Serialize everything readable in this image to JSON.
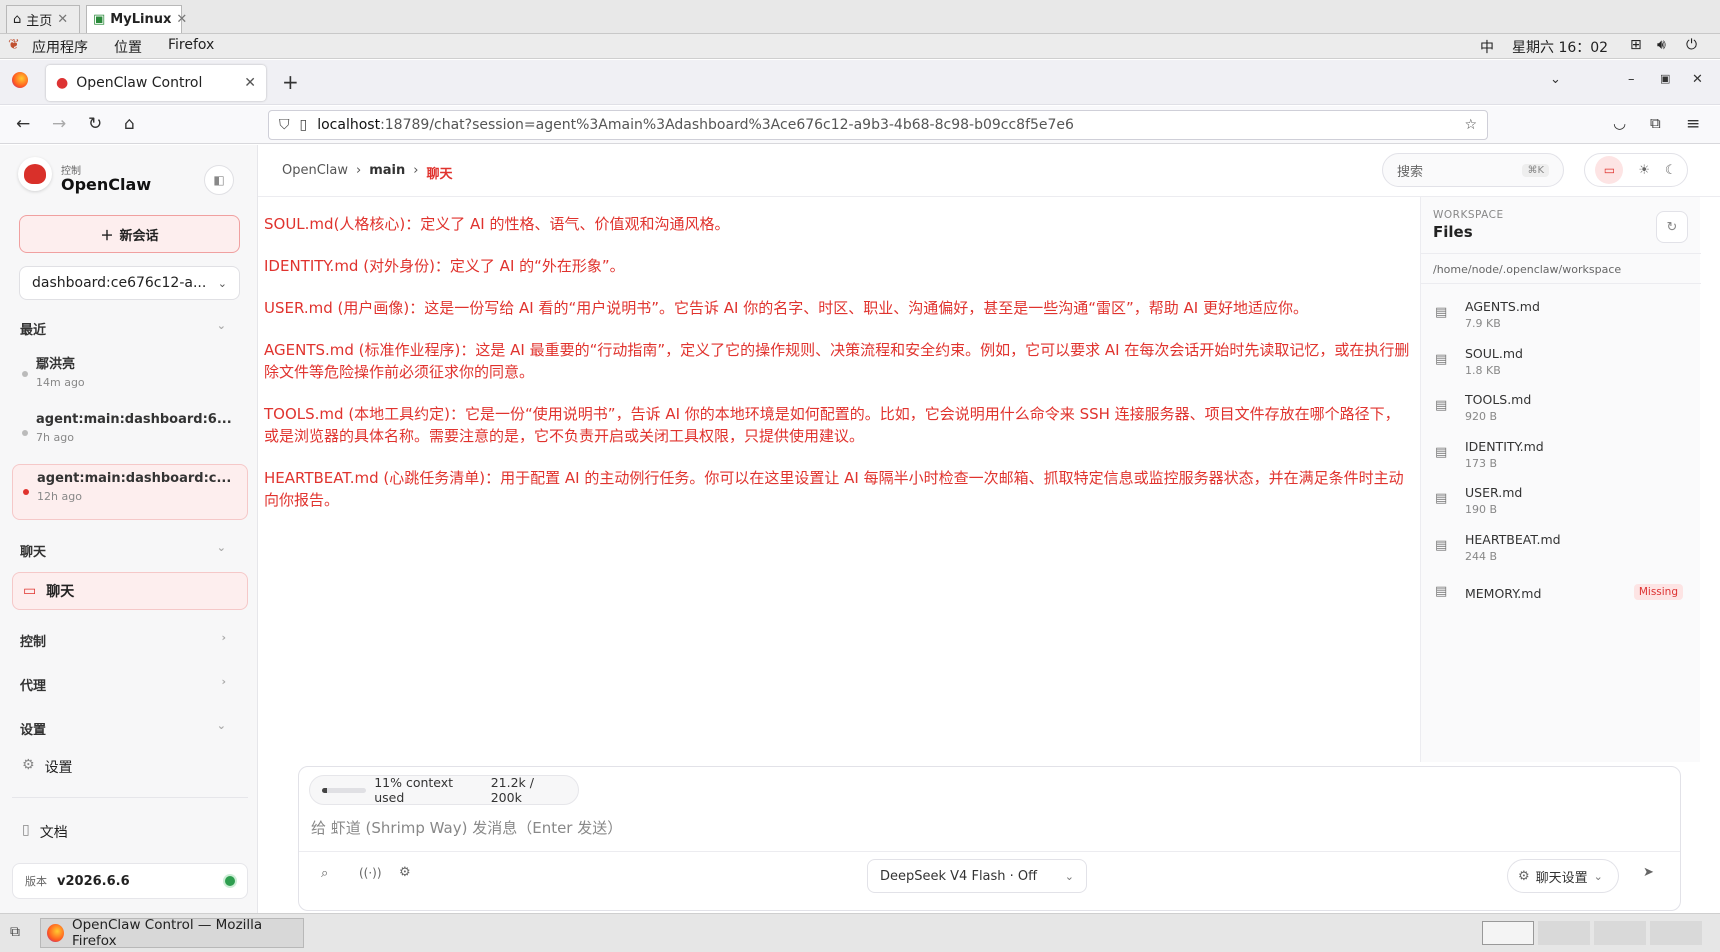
{
  "vnc": {
    "tab1": "主页",
    "tab2": "MyLinux"
  },
  "gnome": {
    "apps": "应用程序",
    "places": "位置",
    "firefox": "Firefox",
    "ime": "中",
    "clock": "星期六 16：02"
  },
  "browser": {
    "tab_title": "OpenClaw Control",
    "url_host": "localhost",
    "url_rest": ":18789/chat?session=agent%3Amain%3Adashboard%3Ace676c12-a9b3-4b68-8c98-b09cc8f5e7e6"
  },
  "sidebar": {
    "brand_sub": "控制",
    "brand": "OpenClaw",
    "new_session": "新会话",
    "session_select": "dashboard:ce676c12-a...",
    "recent_label": "最近",
    "recent": [
      {
        "title": "鄢洪亮",
        "time": "14m ago"
      },
      {
        "title": "agent:main:dashboard:6...",
        "time": "7h ago"
      },
      {
        "title": "agent:main:dashboard:c...",
        "time": "12h ago"
      }
    ],
    "chat_section": "聊天",
    "chat_item": "聊天",
    "control_section": "控制",
    "agent_section": "代理",
    "settings_section": "设置",
    "settings_item": "设置",
    "docs": "文档",
    "version_label": "版本",
    "version": "v2026.6.6"
  },
  "header": {
    "crumb1": "OpenClaw",
    "crumb2": "main",
    "crumb3": "聊天",
    "search_placeholder": "搜索",
    "search_kbd": "⌘K"
  },
  "messages": [
    "SOUL.md(人格核心)：定义了 AI 的性格、语气、价值观和沟通风格。",
    "IDENTITY.md (对外身份)：定义了 AI 的“外在形象”。",
    "USER.md (用户画像)：这是一份写给 AI 看的“用户说明书”。它告诉 AI 你的名字、时区、职业、沟通偏好，甚至是一些沟通“雷区”，帮助 AI 更好地适应你。",
    "AGENTS.md (标准作业程序)：这是 AI 最重要的“行动指南”，定义了它的操作规则、决策流程和安全约束。例如，它可以要求 AI 在每次会话开始时先读取记忆，或在执行删除文件等危险操作前必须征求你的同意。",
    "TOOLS.md (本地工具约定)：它是一份“使用说明书”，告诉 AI 你的本地环境是如何配置的。比如，它会说明用什么命令来 SSH 连接服务器、项目文件存放在哪个路径下，或是浏览器的具体名称。需要注意的是，它不负责开启或关闭工具权限，只提供使用建议。",
    "HEARTBEAT.md (心跳任务清单)：用于配置 AI 的主动例行任务。你可以在这里设置让 AI 每隔半小时检查一次邮箱、抓取特定信息或监控服务器状态，并在满足条件时主动向你报告。"
  ],
  "workspace": {
    "kicker": "WORKSPACE",
    "title": "Files",
    "path": "/home/node/.openclaw/workspace",
    "files": [
      {
        "name": "AGENTS.md",
        "size": "7.9 KB"
      },
      {
        "name": "SOUL.md",
        "size": "1.8 KB"
      },
      {
        "name": "TOOLS.md",
        "size": "920 B"
      },
      {
        "name": "IDENTITY.md",
        "size": "173 B"
      },
      {
        "name": "USER.md",
        "size": "190 B"
      },
      {
        "name": "HEARTBEAT.md",
        "size": "244 B"
      },
      {
        "name": "MEMORY.md",
        "size": ""
      }
    ],
    "missing_badge": "Missing"
  },
  "composer": {
    "context_text": "11% context used",
    "context_tokens": "21.2k / 200k",
    "context_fraction": 0.11,
    "placeholder": "给 虾道 (Shrimp Way) 发消息（Enter 发送）",
    "model": "DeepSeek V4 Flash · Off",
    "chat_settings": "聊天设置"
  },
  "taskbar": {
    "window": "OpenClaw Control — Mozilla Firefox"
  },
  "colors": {
    "accent": "#e0332e",
    "active_bg": "#fdeeee",
    "ok": "#2e9e4f"
  }
}
